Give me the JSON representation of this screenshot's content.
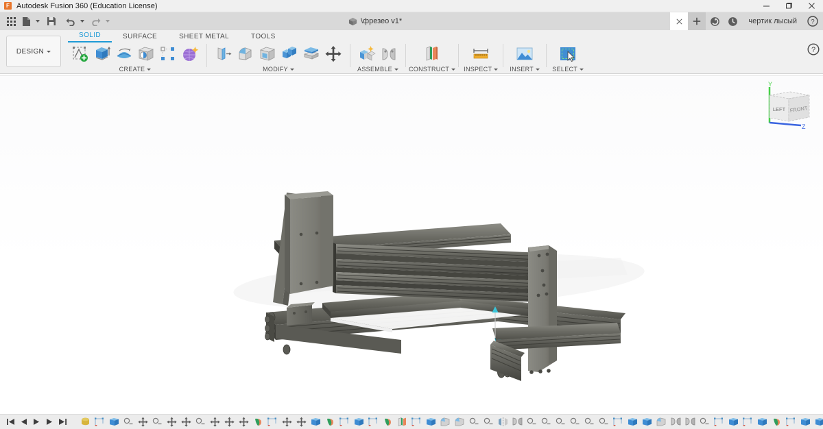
{
  "window": {
    "app_title": "Autodesk Fusion 360 (Education License)",
    "app_icon": "fusion-logo-icon",
    "minimize_label": "minimize-icon",
    "maximize_label": "maximize-icon",
    "close_label": "close-icon"
  },
  "quick_access": {
    "items": [
      {
        "name": "app-grid-icon",
        "label": ""
      },
      {
        "name": "new-file-icon",
        "label": "",
        "caret": true
      },
      {
        "name": "save-icon",
        "label": ""
      },
      {
        "name": "undo-icon",
        "label": "",
        "caret": true
      },
      {
        "name": "redo-icon",
        "label": "",
        "caret": true
      }
    ]
  },
  "document_tab": {
    "title": "\\фрезео v1*",
    "icon": "cube-icon",
    "close_label": "×",
    "new_tab_label": "+"
  },
  "account_bar": {
    "job_status_icon": "job-status-icon",
    "recent_icon": "recent-clock-icon",
    "user_name": "чертик лысый",
    "help_icon": "help-icon"
  },
  "workspace": {
    "selector_label": "DESIGN"
  },
  "ribbon": {
    "tabs": [
      {
        "label": "SOLID",
        "active": true
      },
      {
        "label": "SURFACE",
        "active": false
      },
      {
        "label": "SHEET METAL",
        "active": false
      },
      {
        "label": "TOOLS",
        "active": false
      }
    ],
    "groups": [
      {
        "label": "CREATE",
        "has_caret": true,
        "items": [
          {
            "name": "create-sketch-icon",
            "tooltip": "Create Sketch"
          },
          {
            "name": "extrude-icon",
            "tooltip": "Extrude"
          },
          {
            "name": "revolve-icon",
            "tooltip": "Revolve"
          },
          {
            "name": "hole-icon",
            "tooltip": "Hole"
          },
          {
            "name": "rectangular-pattern-icon",
            "tooltip": "Rectangular Pattern"
          },
          {
            "name": "create-form-icon",
            "tooltip": "Create Form"
          }
        ]
      },
      {
        "label": "MODIFY",
        "has_caret": true,
        "items": [
          {
            "name": "press-pull-icon",
            "tooltip": "Press Pull"
          },
          {
            "name": "fillet-icon",
            "tooltip": "Fillet"
          },
          {
            "name": "shell-icon",
            "tooltip": "Shell"
          },
          {
            "name": "combine-icon",
            "tooltip": "Combine"
          },
          {
            "name": "offset-face-icon",
            "tooltip": "Offset Face"
          },
          {
            "name": "move-copy-icon",
            "tooltip": "Move/Copy"
          }
        ]
      },
      {
        "label": "ASSEMBLE",
        "has_caret": true,
        "items": [
          {
            "name": "new-component-icon",
            "tooltip": "New Component"
          },
          {
            "name": "joint-icon",
            "tooltip": "Joint"
          }
        ]
      },
      {
        "label": "CONSTRUCT",
        "has_caret": true,
        "items": [
          {
            "name": "offset-plane-icon",
            "tooltip": "Offset Plane"
          }
        ]
      },
      {
        "label": "INSPECT",
        "has_caret": true,
        "items": [
          {
            "name": "measure-icon",
            "tooltip": "Measure"
          }
        ]
      },
      {
        "label": "INSERT",
        "has_caret": true,
        "items": [
          {
            "name": "insert-image-icon",
            "tooltip": "Canvas / Decal"
          }
        ]
      },
      {
        "label": "SELECT",
        "has_caret": true,
        "items": [
          {
            "name": "select-icon",
            "tooltip": "Select"
          }
        ]
      }
    ]
  },
  "canvas": {
    "model_description": "CNC router machine frame assembly of aluminium extrusion profiles with vertical gantry side plates",
    "joint_marker_color": "#39c4d8",
    "background_color": "#ffffff",
    "model_color": "#6e6e68",
    "viewcube": {
      "face_left_label": "LEFT",
      "face_front_label": "FRONT",
      "axis_y_label": "Y",
      "axis_z_label": "Z",
      "axis_y_color": "#46d246",
      "axis_z_color": "#3a64e0"
    }
  },
  "timeline": {
    "playback": [
      {
        "name": "timeline-go-start-button"
      },
      {
        "name": "timeline-step-back-button"
      },
      {
        "name": "timeline-play-button"
      },
      {
        "name": "timeline-step-forward-button"
      },
      {
        "name": "timeline-go-end-button"
      }
    ],
    "features": [
      {
        "name": "timeline-feature-component",
        "type": "component"
      },
      {
        "name": "timeline-feature-sketch",
        "type": "sketch"
      },
      {
        "name": "timeline-feature-extrude",
        "type": "extrude"
      },
      {
        "name": "timeline-feature-joint-origin",
        "type": "joint-origin"
      },
      {
        "name": "timeline-feature-move",
        "type": "move"
      },
      {
        "name": "timeline-feature-joint-origin",
        "type": "joint-origin"
      },
      {
        "name": "timeline-feature-move",
        "type": "move"
      },
      {
        "name": "timeline-feature-move",
        "type": "move"
      },
      {
        "name": "timeline-feature-joint-origin",
        "type": "joint-origin"
      },
      {
        "name": "timeline-feature-move",
        "type": "move"
      },
      {
        "name": "timeline-feature-move",
        "type": "move"
      },
      {
        "name": "timeline-feature-move",
        "type": "move"
      },
      {
        "name": "timeline-feature-revolve",
        "type": "revolve"
      },
      {
        "name": "timeline-feature-sketch",
        "type": "sketch"
      },
      {
        "name": "timeline-feature-move",
        "type": "move"
      },
      {
        "name": "timeline-feature-move",
        "type": "move"
      },
      {
        "name": "timeline-feature-extrude",
        "type": "extrude"
      },
      {
        "name": "timeline-feature-revolve",
        "type": "revolve"
      },
      {
        "name": "timeline-feature-sketch",
        "type": "sketch"
      },
      {
        "name": "timeline-feature-extrude",
        "type": "extrude"
      },
      {
        "name": "timeline-feature-sketch",
        "type": "sketch"
      },
      {
        "name": "timeline-feature-revolve",
        "type": "revolve"
      },
      {
        "name": "timeline-feature-plane",
        "type": "plane"
      },
      {
        "name": "timeline-feature-sketch",
        "type": "sketch"
      },
      {
        "name": "timeline-feature-extrude",
        "type": "extrude"
      },
      {
        "name": "timeline-feature-fillet",
        "type": "fillet"
      },
      {
        "name": "timeline-feature-fillet",
        "type": "fillet"
      },
      {
        "name": "timeline-feature-joint-origin",
        "type": "joint-origin"
      },
      {
        "name": "timeline-feature-joint-origin",
        "type": "joint-origin"
      },
      {
        "name": "timeline-feature-mirror",
        "type": "mirror"
      },
      {
        "name": "timeline-feature-joint",
        "type": "joint"
      },
      {
        "name": "timeline-feature-joint-origin",
        "type": "joint-origin"
      },
      {
        "name": "timeline-feature-joint-origin",
        "type": "joint-origin"
      },
      {
        "name": "timeline-feature-joint-origin",
        "type": "joint-origin"
      },
      {
        "name": "timeline-feature-joint-origin",
        "type": "joint-origin"
      },
      {
        "name": "timeline-feature-joint-origin",
        "type": "joint-origin"
      },
      {
        "name": "timeline-feature-joint-origin",
        "type": "joint-origin"
      },
      {
        "name": "timeline-feature-sketch",
        "type": "sketch"
      },
      {
        "name": "timeline-feature-extrude",
        "type": "extrude"
      },
      {
        "name": "timeline-feature-extrude",
        "type": "extrude"
      },
      {
        "name": "timeline-feature-fillet",
        "type": "fillet"
      },
      {
        "name": "timeline-feature-joint",
        "type": "joint"
      },
      {
        "name": "timeline-feature-joint",
        "type": "joint"
      },
      {
        "name": "timeline-feature-joint-origin",
        "type": "joint-origin"
      },
      {
        "name": "timeline-feature-sketch",
        "type": "sketch"
      },
      {
        "name": "timeline-feature-extrude",
        "type": "extrude"
      },
      {
        "name": "timeline-feature-sketch",
        "type": "sketch"
      },
      {
        "name": "timeline-feature-extrude",
        "type": "extrude"
      },
      {
        "name": "timeline-feature-revolve",
        "type": "revolve"
      },
      {
        "name": "timeline-feature-sketch",
        "type": "sketch"
      },
      {
        "name": "timeline-feature-extrude",
        "type": "extrude"
      },
      {
        "name": "timeline-feature-extrude",
        "type": "extrude"
      }
    ],
    "end_marker": "timeline-end-marker",
    "settings_icon": "timeline-settings-gear-icon"
  }
}
